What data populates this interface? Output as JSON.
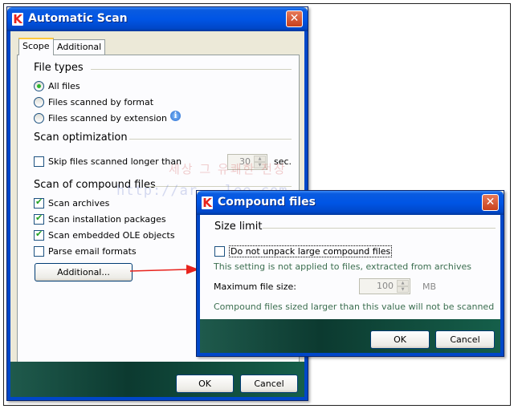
{
  "scan_dialog": {
    "title": "Automatic Scan",
    "tabs": [
      "Scope",
      "Additional"
    ],
    "file_types": {
      "heading": "File types",
      "options": [
        "All files",
        "Files scanned by format",
        "Files scanned by extension"
      ],
      "selected": "All files"
    },
    "scan_optimization": {
      "heading": "Scan optimization",
      "skip_label": "Skip files scanned longer than",
      "skip_checked": false,
      "skip_value": "30",
      "skip_unit": "sec."
    },
    "compound": {
      "heading": "Scan of compound files",
      "items": [
        {
          "label": "Scan archives",
          "checked": true
        },
        {
          "label": "Scan installation packages",
          "checked": true
        },
        {
          "label": "Scan embedded OLE objects",
          "checked": true
        },
        {
          "label": "Parse email formats",
          "checked": false
        }
      ],
      "additional_button": "Additional..."
    },
    "ok": "OK",
    "cancel": "Cancel"
  },
  "compound_dialog": {
    "title": "Compound files",
    "heading": "Size limit",
    "checkbox_label": "Do not unpack large compound files",
    "checkbox_checked": false,
    "note1": "This setting is not applied to files, extracted from archives",
    "max_size_label": "Maximum file size:",
    "max_size_value": "100",
    "max_size_unit": "MB",
    "note2": "Compound files sized larger than this value will not be scanned",
    "ok": "OK",
    "cancel": "Cancel"
  },
  "watermark": {
    "line1": "세상 그 유쾌한 전장",
    "line2": "http://ar...lee.com"
  },
  "icons": {
    "app_logo": "K",
    "close": "✕",
    "info": "i",
    "arrow_color": "#e8231d"
  }
}
